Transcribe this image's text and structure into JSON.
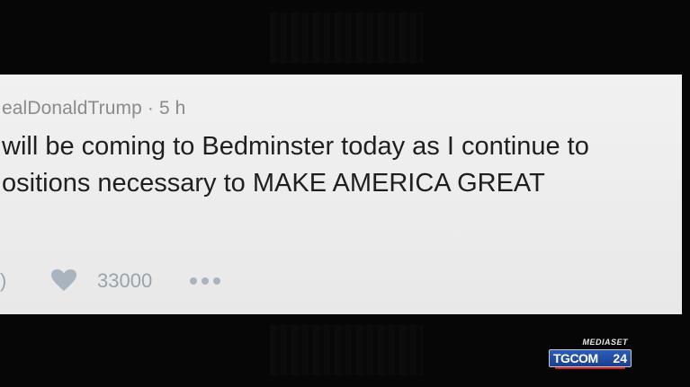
{
  "tweet": {
    "handle": "ealDonaldTrump",
    "separator": "·",
    "time": "5 h",
    "lines": [
      "will be coming to Bedminster today as I continue to",
      "ositions necessary to MAKE AMERICA GREAT"
    ],
    "reply_fragment": ")",
    "like_count": "33000",
    "more_icon": "ellipsis-icon",
    "like_icon": "heart-icon"
  },
  "logo": {
    "top": "MEDIASET",
    "main": "TGCOM",
    "number": "24"
  },
  "colors": {
    "background": "#060606",
    "card": "#ececec",
    "text": "#1f1f1f",
    "meta": "#8b8b8b",
    "icon": "#aab4be",
    "logo_blue": "#1b3f8f",
    "logo_red": "#d81e1e"
  }
}
